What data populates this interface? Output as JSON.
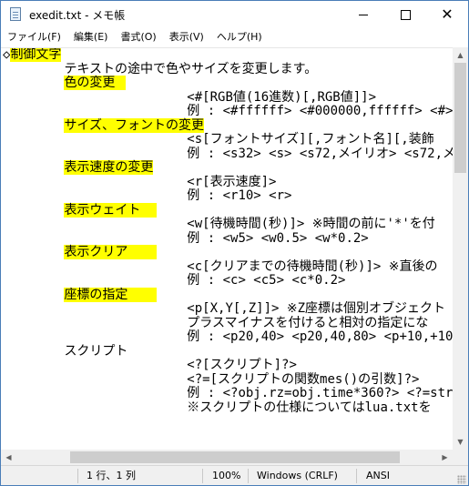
{
  "window": {
    "title": "exedit.txt - メモ帳",
    "icon": "notepad-icon",
    "controls": {
      "minimize": "minimize-icon",
      "maximize": "maximize-icon",
      "close": "close-icon"
    }
  },
  "menu": [
    "ファイル(F)",
    "編集(E)",
    "書式(O)",
    "表示(V)",
    "ヘルプ(H)"
  ],
  "editor": {
    "highlight_color": "#ffff00",
    "lines": [
      {
        "pre": "◇",
        "hl": "制御文字",
        "post": ""
      },
      {
        "pre": "\t\tテキストの途中で色やサイズを変更します。",
        "hl": "",
        "post": ""
      },
      {
        "pre": "\t\t",
        "hl": "色の変更\t",
        "post": ""
      },
      {
        "pre": "\t\t\t\t\t\t<#[RGB値(16進数)[,RGB値]]>",
        "hl": "",
        "post": ""
      },
      {
        "pre": "\t\t\t\t\t\t例 : <#ffffff> <#000000,ffffff> <#>",
        "hl": "",
        "post": ""
      },
      {
        "pre": "\t\t",
        "hl": "サイズ、フォントの変更",
        "post": ""
      },
      {
        "pre": "\t\t\t\t\t\t<s[フォントサイズ][,フォント名][,装飾",
        "hl": "",
        "post": ""
      },
      {
        "pre": "\t\t\t\t\t\t例 : <s32> <s> <s72,メイリオ> <s72,メ",
        "hl": "",
        "post": ""
      },
      {
        "pre": "\t\t",
        "hl": "表示速度の変更",
        "post": ""
      },
      {
        "pre": "\t\t\t\t\t\t<r[表示速度]>",
        "hl": "",
        "post": ""
      },
      {
        "pre": "\t\t\t\t\t\t例 : <r10> <r>",
        "hl": "",
        "post": ""
      },
      {
        "pre": "\t\t",
        "hl": "表示ウェイト\t",
        "post": ""
      },
      {
        "pre": "\t\t\t\t\t\t<w[待機時間(秒)]> ※時間の前に'*'を付",
        "hl": "",
        "post": ""
      },
      {
        "pre": "\t\t\t\t\t\t例 : <w5> <w0.5> <w*0.2>",
        "hl": "",
        "post": ""
      },
      {
        "pre": "\t\t",
        "hl": "表示クリア\t",
        "post": ""
      },
      {
        "pre": "\t\t\t\t\t\t<c[クリアまでの待機時間(秒)]> ※直後の",
        "hl": "",
        "post": ""
      },
      {
        "pre": "\t\t\t\t\t\t例 : <c> <c5> <c*0.2>",
        "hl": "",
        "post": ""
      },
      {
        "pre": "\t\t",
        "hl": "座標の指定\t",
        "post": ""
      },
      {
        "pre": "\t\t\t\t\t\t<p[X,Y[,Z]]> ※Z座標は個別オブジェクト",
        "hl": "",
        "post": ""
      },
      {
        "pre": "\t\t\t\t\t\tプラスマイナスを付けると相対の指定にな",
        "hl": "",
        "post": ""
      },
      {
        "pre": "\t\t\t\t\t\t例 : <p20,40> <p20,40,80> <p+10,+10>",
        "hl": "",
        "post": ""
      },
      {
        "pre": "\t\tスクリプト",
        "hl": "",
        "post": ""
      },
      {
        "pre": "\t\t\t\t\t\t<?[スクリプト]?>",
        "hl": "",
        "post": ""
      },
      {
        "pre": "\t\t\t\t\t\t<?=[スクリプトの関数mes()の引数]?>",
        "hl": "",
        "post": ""
      },
      {
        "pre": "\t\t\t\t\t\t例 : <?obj.rz=obj.time*360?> <?=strin",
        "hl": "",
        "post": ""
      },
      {
        "pre": "\t\t\t\t\t\t※スクリプトの仕様についてはlua.txtを",
        "hl": "",
        "post": ""
      }
    ]
  },
  "status": {
    "position": "1 行、1 列",
    "zoom": "100%",
    "line_ending": "Windows (CRLF)",
    "encoding": "ANSI"
  }
}
